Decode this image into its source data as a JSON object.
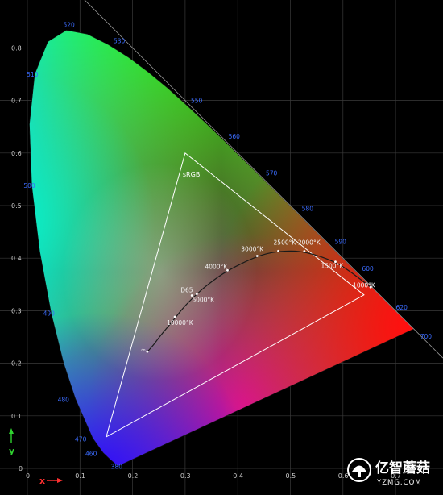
{
  "chart_data": {
    "type": "scatter",
    "title": "",
    "xlabel": "x",
    "ylabel": "y",
    "xlim": [
      0,
      0.8
    ],
    "ylim": [
      0,
      0.9
    ],
    "grid": true,
    "x_ticks": [
      "0",
      "0.1",
      "0.2",
      "0.3",
      "0.4",
      "0.5",
      "0.6",
      "0.7"
    ],
    "y_ticks": [
      "0",
      "0.1",
      "0.2",
      "0.3",
      "0.4",
      "0.5",
      "0.6",
      "0.7",
      "0.8"
    ],
    "spectral_locus": [
      [
        0.1741,
        0.005
      ],
      [
        0.1738,
        0.0049
      ],
      [
        0.1736,
        0.0049
      ],
      [
        0.1733,
        0.0048
      ],
      [
        0.1726,
        0.0048
      ],
      [
        0.1714,
        0.0051
      ],
      [
        0.1689,
        0.0069
      ],
      [
        0.1644,
        0.0109
      ],
      [
        0.1566,
        0.0177
      ],
      [
        0.144,
        0.0297
      ],
      [
        0.1241,
        0.0578
      ],
      [
        0.0913,
        0.1327
      ],
      [
        0.0687,
        0.2007
      ],
      [
        0.0454,
        0.295
      ],
      [
        0.0235,
        0.4127
      ],
      [
        0.0082,
        0.5384
      ],
      [
        0.0039,
        0.6548
      ],
      [
        0.0139,
        0.7502
      ],
      [
        0.0389,
        0.812
      ],
      [
        0.0743,
        0.8338
      ],
      [
        0.1142,
        0.8262
      ],
      [
        0.1547,
        0.8059
      ],
      [
        0.1929,
        0.7816
      ],
      [
        0.2296,
        0.7543
      ],
      [
        0.2658,
        0.7243
      ],
      [
        0.3016,
        0.6923
      ],
      [
        0.3373,
        0.6589
      ],
      [
        0.3731,
        0.6245
      ],
      [
        0.4087,
        0.5896
      ],
      [
        0.4441,
        0.5547
      ],
      [
        0.4788,
        0.5202
      ],
      [
        0.5125,
        0.4866
      ],
      [
        0.5448,
        0.4544
      ],
      [
        0.5752,
        0.4242
      ],
      [
        0.6029,
        0.3965
      ],
      [
        0.627,
        0.3725
      ],
      [
        0.6482,
        0.3514
      ],
      [
        0.6658,
        0.334
      ],
      [
        0.6801,
        0.3197
      ],
      [
        0.6915,
        0.3083
      ],
      [
        0.7006,
        0.2993
      ],
      [
        0.7079,
        0.292
      ],
      [
        0.714,
        0.2859
      ],
      [
        0.719,
        0.2809
      ],
      [
        0.723,
        0.277
      ],
      [
        0.726,
        0.274
      ],
      [
        0.7283,
        0.2717
      ],
      [
        0.73,
        0.27
      ],
      [
        0.7311,
        0.2689
      ],
      [
        0.732,
        0.268
      ],
      [
        0.7327,
        0.2673
      ],
      [
        0.7334,
        0.2666
      ],
      [
        0.734,
        0.266
      ],
      [
        0.7344,
        0.2656
      ],
      [
        0.7346,
        0.2654
      ],
      [
        0.7347,
        0.2653
      ]
    ],
    "wavelength_labels": [
      {
        "text": "520",
        "x": 0.0743,
        "y": 0.8338
      },
      {
        "text": "530",
        "x": 0.1547,
        "y": 0.8059
      },
      {
        "text": "510",
        "x": 0.0139,
        "y": 0.7502
      },
      {
        "text": "550",
        "x": 0.3016,
        "y": 0.6923
      },
      {
        "text": "560",
        "x": 0.3731,
        "y": 0.6245
      },
      {
        "text": "570",
        "x": 0.4441,
        "y": 0.5547
      },
      {
        "text": "500",
        "x": 0.0082,
        "y": 0.5384
      },
      {
        "text": "580",
        "x": 0.5125,
        "y": 0.4866
      },
      {
        "text": "590",
        "x": 0.5752,
        "y": 0.4242
      },
      {
        "text": "600",
        "x": 0.627,
        "y": 0.3725
      },
      {
        "text": "620",
        "x": 0.6915,
        "y": 0.3083
      },
      {
        "text": "490",
        "x": 0.0454,
        "y": 0.295
      },
      {
        "text": "700",
        "x": 0.7347,
        "y": 0.2653
      },
      {
        "text": "480",
        "x": 0.0913,
        "y": 0.1327
      },
      {
        "text": "470",
        "x": 0.1241,
        "y": 0.0578
      },
      {
        "text": "460",
        "x": 0.144,
        "y": 0.0297
      },
      {
        "text": "380",
        "x": 0.1741,
        "y": 0.005
      }
    ],
    "srgb_gamut": {
      "label": "sRGB",
      "points": [
        [
          0.64,
          0.33
        ],
        [
          0.3,
          0.6
        ],
        [
          0.15,
          0.06
        ]
      ]
    },
    "planckian_locus": [
      [
        0.228,
        0.222
      ],
      [
        0.2399,
        0.2348
      ],
      [
        0.2525,
        0.2522
      ],
      [
        0.2747,
        0.2781
      ],
      [
        0.2952,
        0.3048
      ],
      [
        0.3221,
        0.3318
      ],
      [
        0.3451,
        0.3516
      ],
      [
        0.3805,
        0.3768
      ],
      [
        0.4369,
        0.4041
      ],
      [
        0.4771,
        0.4137
      ],
      [
        0.5266,
        0.4133
      ],
      [
        0.5857,
        0.3931
      ],
      [
        0.6159,
        0.3733
      ],
      [
        0.6525,
        0.3447
      ]
    ],
    "planckian_labels": [
      {
        "text": "∞",
        "x": 0.228,
        "y": 0.222
      },
      {
        "text": "10000°K",
        "x": 0.2804,
        "y": 0.2883
      },
      {
        "text": "6000°K",
        "x": 0.3221,
        "y": 0.3318
      },
      {
        "text": "D65",
        "x": 0.3127,
        "y": 0.329
      },
      {
        "text": "4000°K",
        "x": 0.3805,
        "y": 0.3768
      },
      {
        "text": "3000°K",
        "x": 0.4369,
        "y": 0.4041
      },
      {
        "text": "2500°K",
        "x": 0.4771,
        "y": 0.4137
      },
      {
        "text": "2000°K",
        "x": 0.5266,
        "y": 0.4133
      },
      {
        "text": "1500°K",
        "x": 0.5857,
        "y": 0.3931
      },
      {
        "text": "1000°K",
        "x": 0.6525,
        "y": 0.3447
      }
    ]
  },
  "watermark": {
    "title": "亿智蘑菇",
    "subtitle": "YZMG.COM"
  }
}
